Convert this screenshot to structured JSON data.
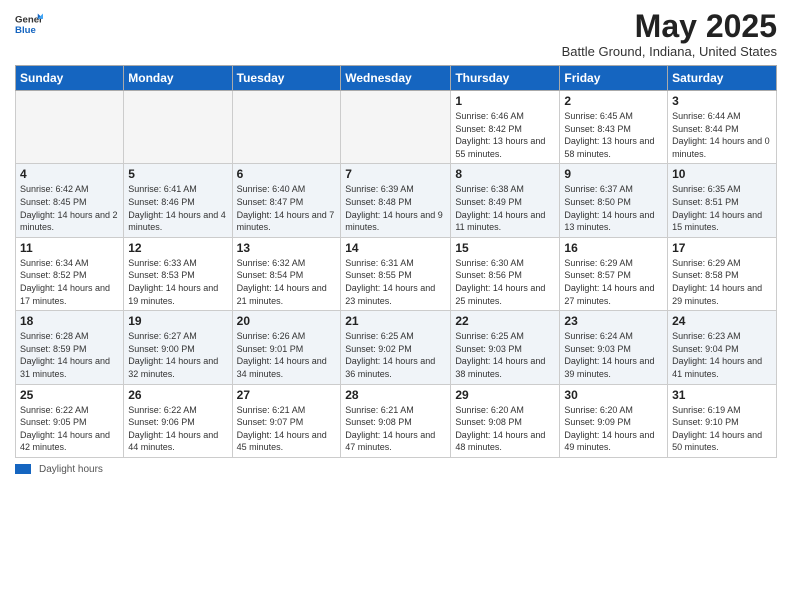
{
  "header": {
    "logo_general": "General",
    "logo_blue": "Blue",
    "month_title": "May 2025",
    "subtitle": "Battle Ground, Indiana, United States"
  },
  "days_of_week": [
    "Sunday",
    "Monday",
    "Tuesday",
    "Wednesday",
    "Thursday",
    "Friday",
    "Saturday"
  ],
  "footer": {
    "swatch_label": "Daylight hours"
  },
  "weeks": [
    [
      {
        "day": "",
        "info": ""
      },
      {
        "day": "",
        "info": ""
      },
      {
        "day": "",
        "info": ""
      },
      {
        "day": "",
        "info": ""
      },
      {
        "day": "1",
        "info": "Sunrise: 6:46 AM\nSunset: 8:42 PM\nDaylight: 13 hours and 55 minutes."
      },
      {
        "day": "2",
        "info": "Sunrise: 6:45 AM\nSunset: 8:43 PM\nDaylight: 13 hours and 58 minutes."
      },
      {
        "day": "3",
        "info": "Sunrise: 6:44 AM\nSunset: 8:44 PM\nDaylight: 14 hours and 0 minutes."
      }
    ],
    [
      {
        "day": "4",
        "info": "Sunrise: 6:42 AM\nSunset: 8:45 PM\nDaylight: 14 hours and 2 minutes."
      },
      {
        "day": "5",
        "info": "Sunrise: 6:41 AM\nSunset: 8:46 PM\nDaylight: 14 hours and 4 minutes."
      },
      {
        "day": "6",
        "info": "Sunrise: 6:40 AM\nSunset: 8:47 PM\nDaylight: 14 hours and 7 minutes."
      },
      {
        "day": "7",
        "info": "Sunrise: 6:39 AM\nSunset: 8:48 PM\nDaylight: 14 hours and 9 minutes."
      },
      {
        "day": "8",
        "info": "Sunrise: 6:38 AM\nSunset: 8:49 PM\nDaylight: 14 hours and 11 minutes."
      },
      {
        "day": "9",
        "info": "Sunrise: 6:37 AM\nSunset: 8:50 PM\nDaylight: 14 hours and 13 minutes."
      },
      {
        "day": "10",
        "info": "Sunrise: 6:35 AM\nSunset: 8:51 PM\nDaylight: 14 hours and 15 minutes."
      }
    ],
    [
      {
        "day": "11",
        "info": "Sunrise: 6:34 AM\nSunset: 8:52 PM\nDaylight: 14 hours and 17 minutes."
      },
      {
        "day": "12",
        "info": "Sunrise: 6:33 AM\nSunset: 8:53 PM\nDaylight: 14 hours and 19 minutes."
      },
      {
        "day": "13",
        "info": "Sunrise: 6:32 AM\nSunset: 8:54 PM\nDaylight: 14 hours and 21 minutes."
      },
      {
        "day": "14",
        "info": "Sunrise: 6:31 AM\nSunset: 8:55 PM\nDaylight: 14 hours and 23 minutes."
      },
      {
        "day": "15",
        "info": "Sunrise: 6:30 AM\nSunset: 8:56 PM\nDaylight: 14 hours and 25 minutes."
      },
      {
        "day": "16",
        "info": "Sunrise: 6:29 AM\nSunset: 8:57 PM\nDaylight: 14 hours and 27 minutes."
      },
      {
        "day": "17",
        "info": "Sunrise: 6:29 AM\nSunset: 8:58 PM\nDaylight: 14 hours and 29 minutes."
      }
    ],
    [
      {
        "day": "18",
        "info": "Sunrise: 6:28 AM\nSunset: 8:59 PM\nDaylight: 14 hours and 31 minutes."
      },
      {
        "day": "19",
        "info": "Sunrise: 6:27 AM\nSunset: 9:00 PM\nDaylight: 14 hours and 32 minutes."
      },
      {
        "day": "20",
        "info": "Sunrise: 6:26 AM\nSunset: 9:01 PM\nDaylight: 14 hours and 34 minutes."
      },
      {
        "day": "21",
        "info": "Sunrise: 6:25 AM\nSunset: 9:02 PM\nDaylight: 14 hours and 36 minutes."
      },
      {
        "day": "22",
        "info": "Sunrise: 6:25 AM\nSunset: 9:03 PM\nDaylight: 14 hours and 38 minutes."
      },
      {
        "day": "23",
        "info": "Sunrise: 6:24 AM\nSunset: 9:03 PM\nDaylight: 14 hours and 39 minutes."
      },
      {
        "day": "24",
        "info": "Sunrise: 6:23 AM\nSunset: 9:04 PM\nDaylight: 14 hours and 41 minutes."
      }
    ],
    [
      {
        "day": "25",
        "info": "Sunrise: 6:22 AM\nSunset: 9:05 PM\nDaylight: 14 hours and 42 minutes."
      },
      {
        "day": "26",
        "info": "Sunrise: 6:22 AM\nSunset: 9:06 PM\nDaylight: 14 hours and 44 minutes."
      },
      {
        "day": "27",
        "info": "Sunrise: 6:21 AM\nSunset: 9:07 PM\nDaylight: 14 hours and 45 minutes."
      },
      {
        "day": "28",
        "info": "Sunrise: 6:21 AM\nSunset: 9:08 PM\nDaylight: 14 hours and 47 minutes."
      },
      {
        "day": "29",
        "info": "Sunrise: 6:20 AM\nSunset: 9:08 PM\nDaylight: 14 hours and 48 minutes."
      },
      {
        "day": "30",
        "info": "Sunrise: 6:20 AM\nSunset: 9:09 PM\nDaylight: 14 hours and 49 minutes."
      },
      {
        "day": "31",
        "info": "Sunrise: 6:19 AM\nSunset: 9:10 PM\nDaylight: 14 hours and 50 minutes."
      }
    ]
  ]
}
